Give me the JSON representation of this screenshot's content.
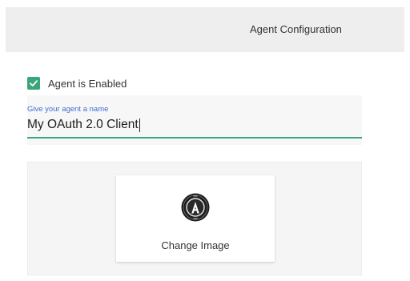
{
  "header": {
    "title": "Agent Configuration"
  },
  "agent": {
    "enabled_label": "Agent is Enabled",
    "enabled": true
  },
  "name_field": {
    "label": "Give your agent a name",
    "value": "My OAuth 2.0 Client"
  },
  "image": {
    "button_label": "Change Image",
    "logo_icon": "agent-logo-icon"
  },
  "colors": {
    "accent": "#3aa57a",
    "label_blue": "#3f6fd6",
    "header_bg": "#eeeeee"
  }
}
